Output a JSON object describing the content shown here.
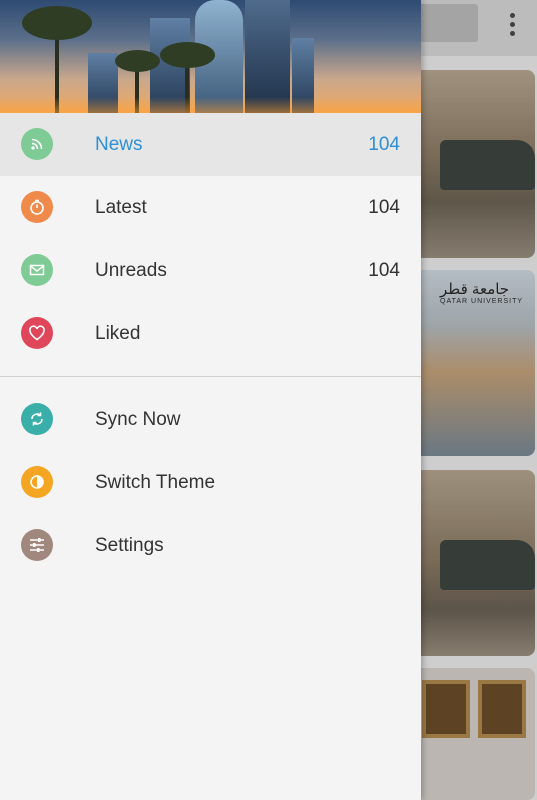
{
  "background": {
    "card_2_caption": "جامعة قطر",
    "card_2_subcaption": "QATAR UNIVERSITY"
  },
  "drawer": {
    "items": [
      {
        "label": "News",
        "count": "104",
        "icon": "rss-icon",
        "color": "#7ecb95",
        "active": true
      },
      {
        "label": "Latest",
        "count": "104",
        "icon": "timer-icon",
        "color": "#f08a4b"
      },
      {
        "label": "Unreads",
        "count": "104",
        "icon": "mail-icon",
        "color": "#7ecb95"
      },
      {
        "label": "Liked",
        "count": "",
        "icon": "heart-icon",
        "color": "#e0465a"
      }
    ],
    "actions": [
      {
        "label": "Sync Now",
        "icon": "sync-icon",
        "color": "#3aafa9"
      },
      {
        "label": "Switch Theme",
        "icon": "theme-icon",
        "color": "#f4a623"
      },
      {
        "label": "Settings",
        "icon": "sliders-icon",
        "color": "#a1887f"
      }
    ]
  },
  "colors": {
    "accent": "#2d8fd8",
    "drawer_bg": "#f4f4f4",
    "active_bg": "#e6e6e6"
  }
}
